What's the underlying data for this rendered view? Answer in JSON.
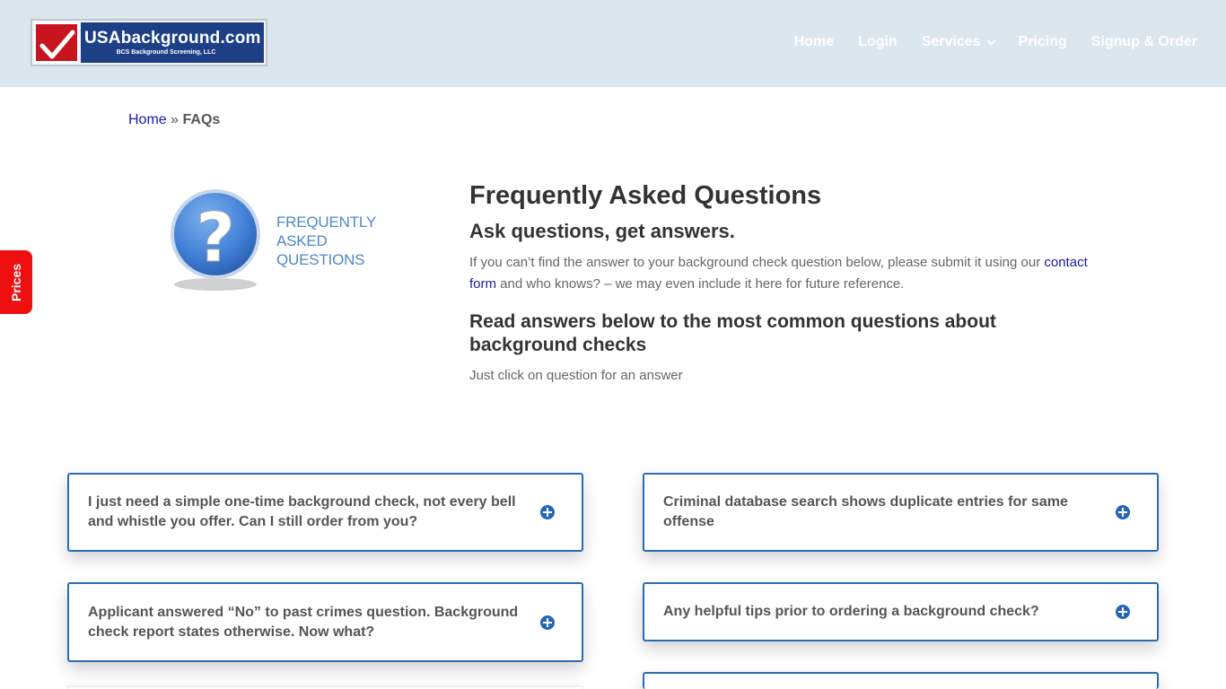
{
  "logo": {
    "main": "USAbackground.com",
    "sub": "BCS Background Screening, LLC"
  },
  "nav": {
    "items": [
      "Home",
      "Login",
      "Services",
      "Pricing",
      "Signup & Order"
    ]
  },
  "breadcrumb": {
    "home": "Home",
    "sep": "»",
    "current": "FAQs"
  },
  "side_tab": {
    "label": "Prices"
  },
  "faq_image": {
    "line1": "FREQUENTLY",
    "line2": "ASKED",
    "line3": "QUESTIONS"
  },
  "intro": {
    "title": "Frequently Asked Questions",
    "subtitle": "Ask questions, get answers.",
    "para_before": "If you can’t find the answer to your background check question below, please submit it using our ",
    "para_link": "contact form",
    "para_after": " and who knows? – we may even include it here for future reference.",
    "read_heading": "Read answers below to the most common questions about background checks",
    "hint": "Just click on question for an answer"
  },
  "faqs": [
    "I just need a simple one-time background check, not every bell and whistle you offer. Can I still order from you?",
    "Criminal database search shows duplicate entries for same offense",
    "Applicant answered “No” to past crimes question. Background check report states otherwise. Now what?",
    "Any helpful tips prior to ordering a background check?",
    "",
    ""
  ],
  "colors": {
    "header_bg": "#dce6ef",
    "accent_blue": "#2a6cb3",
    "prices_red": "#ee1010",
    "link": "#1a1aa6"
  },
  "icons": {
    "expand": "plus-circle-icon",
    "logo_check": "checkmark-icon",
    "faq_bubble": "question-mark-icon"
  }
}
